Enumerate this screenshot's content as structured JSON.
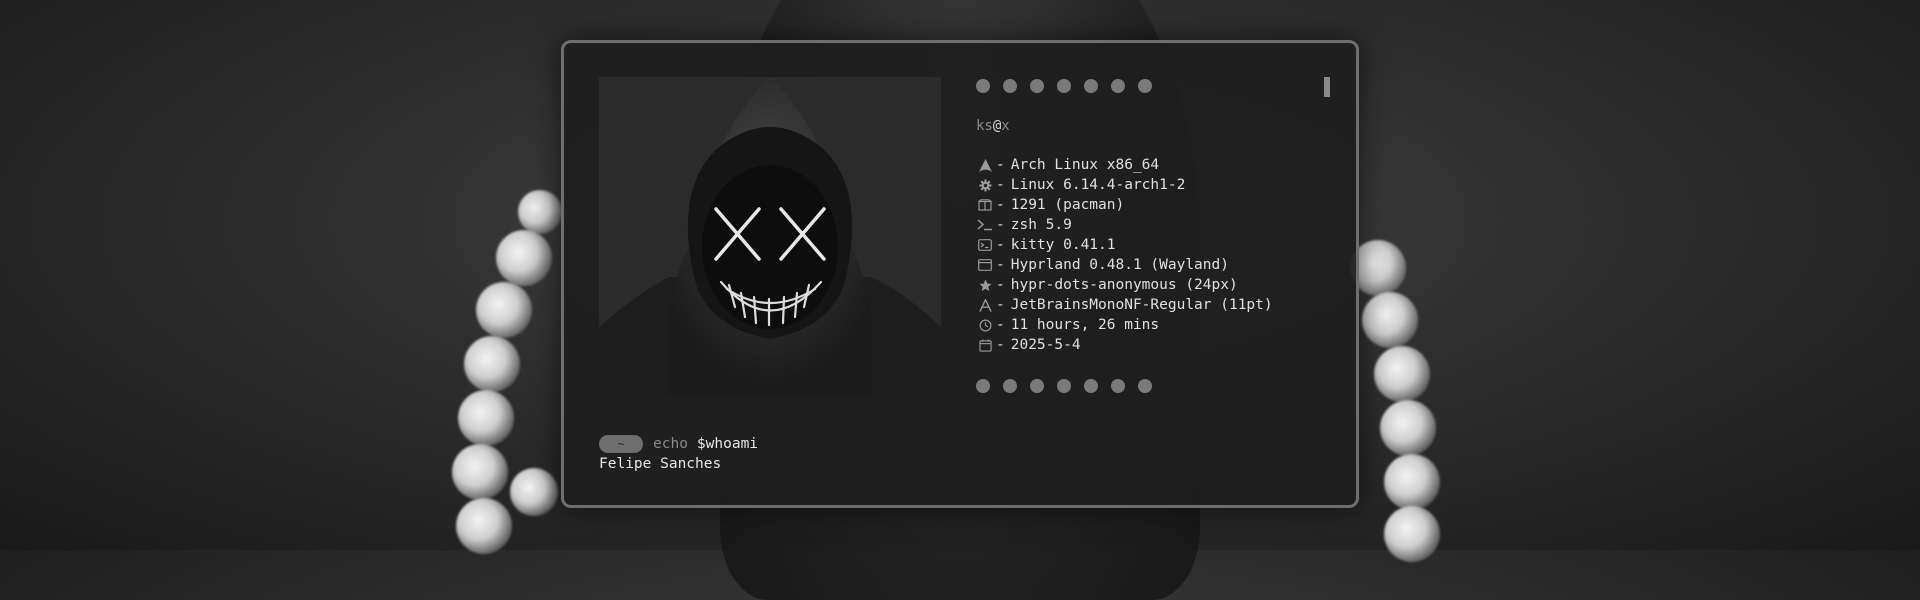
{
  "fetch": {
    "user": "ks",
    "at": "@",
    "host": "x",
    "rows": [
      {
        "icon": "arch-logo-icon",
        "value": "Arch Linux x86_64"
      },
      {
        "icon": "gear-icon",
        "value": "Linux 6.14.4-arch1-2"
      },
      {
        "icon": "package-icon",
        "value": "1291 (pacman)"
      },
      {
        "icon": "shell-prompt-icon",
        "value": "zsh 5.9"
      },
      {
        "icon": "terminal-icon",
        "value": "kitty 0.41.1"
      },
      {
        "icon": "window-icon",
        "value": "Hyprland 0.48.1 (Wayland)"
      },
      {
        "icon": "star-icon",
        "value": "hypr-dots-anonymous (24px)"
      },
      {
        "icon": "font-icon",
        "value": "JetBrainsMonoNF-Regular (11pt)"
      },
      {
        "icon": "clock-icon",
        "value": "11 hours, 26 mins"
      },
      {
        "icon": "calendar-icon",
        "value": "2025-5-4"
      }
    ],
    "separator": "-"
  },
  "prompt": {
    "dir": "~",
    "command": "echo",
    "argument": "$whoami"
  },
  "output": "Felipe Sanches",
  "colors": {
    "border": "#6e6e6e",
    "text": "#e0e0e0",
    "dim": "#8c8c8c",
    "dot": "#7a7a7a"
  }
}
